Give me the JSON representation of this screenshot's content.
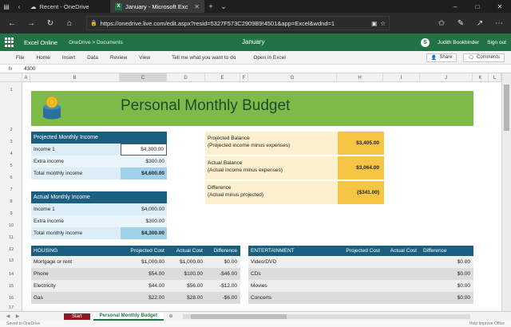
{
  "browser": {
    "tabs": [
      {
        "title": "Recent - OneDrive",
        "active": false
      },
      {
        "title": "January - Microsoft Exc",
        "active": true
      }
    ],
    "url": "https://onedrive.live.com/edit.aspx?resid=5327F573C2909B9!4501&app=Excel&wdnd=1"
  },
  "excel": {
    "app_name": "Excel Online",
    "breadcrumb": "OneDrive > Documents",
    "doc_title": "January",
    "user": "Judith Bookbinder",
    "sign_out": "Sign out",
    "menu": [
      "File",
      "Home",
      "Insert",
      "Data",
      "Review",
      "View"
    ],
    "tell_me": "Tell me what you want to do",
    "open_in_excel": "Open in Excel",
    "share": "Share",
    "comments": "Comments",
    "formula_value": "4300"
  },
  "grid": {
    "columns": [
      "A",
      "B",
      "C",
      "D",
      "E",
      "F",
      "G",
      "H",
      "I",
      "J",
      "K",
      "L"
    ],
    "rows": [
      "1",
      "2",
      "3",
      "4",
      "5",
      "6",
      "7",
      "8",
      "9",
      "10",
      "11",
      "12",
      "13",
      "14",
      "15",
      "16",
      "17",
      "18",
      "19"
    ],
    "title": "Personal Monthly Budget",
    "projected_income": {
      "header": "Projected Monthly Income",
      "rows": [
        {
          "label": "Income 1",
          "value": "$4,300.00"
        },
        {
          "label": "Extra income",
          "value": "$300.00"
        },
        {
          "label": "Total monthly income",
          "value": "$4,600.00"
        }
      ]
    },
    "actual_income": {
      "header": "Actual Monthly Income",
      "rows": [
        {
          "label": "Income 1",
          "value": "$4,000.00"
        },
        {
          "label": "Extra income",
          "value": "$300.00"
        },
        {
          "label": "Total monthly income",
          "value": "$4,300.00"
        }
      ]
    },
    "balances": [
      {
        "line1": "Projected Balance",
        "line2": "(Projected income minus expenses)",
        "value": "$3,405.00"
      },
      {
        "line1": "Actual Balance",
        "line2": "(Actual income minus expenses)",
        "value": "$3,064.00"
      },
      {
        "line1": "Difference",
        "line2": "(Actual minus projected)",
        "value": "($341.00)"
      }
    ],
    "housing": {
      "headers": [
        "HOUSING",
        "Projected Cost",
        "Actual Cost",
        "Difference"
      ],
      "rows": [
        [
          "Mortgage or rent",
          "$1,000.00",
          "$1,000.00",
          "$0.00"
        ],
        [
          "Phone",
          "$54.00",
          "$100.00",
          "-$46.00"
        ],
        [
          "Electricity",
          "$44.00",
          "$56.00",
          "-$12.00"
        ],
        [
          "Gas",
          "$22.00",
          "$28.00",
          "-$6.00"
        ]
      ]
    },
    "entertainment": {
      "headers": [
        "ENTERTAINMENT",
        "Projected Cost",
        "Actual Cost",
        "Difference"
      ],
      "rows": [
        [
          "Video/DVD",
          "",
          "",
          "$0.00"
        ],
        [
          "CDs",
          "",
          "",
          "$0.00"
        ],
        [
          "Movies",
          "",
          "",
          "$0.00"
        ],
        [
          "Concerts",
          "",
          "",
          "$0.00"
        ]
      ]
    }
  },
  "sheets": [
    {
      "name": "Start",
      "active": false
    },
    {
      "name": "Personal Monthly Budget",
      "active": true
    }
  ],
  "status": {
    "left": "Saved to OneDrive",
    "right": "Help Improve Office"
  }
}
